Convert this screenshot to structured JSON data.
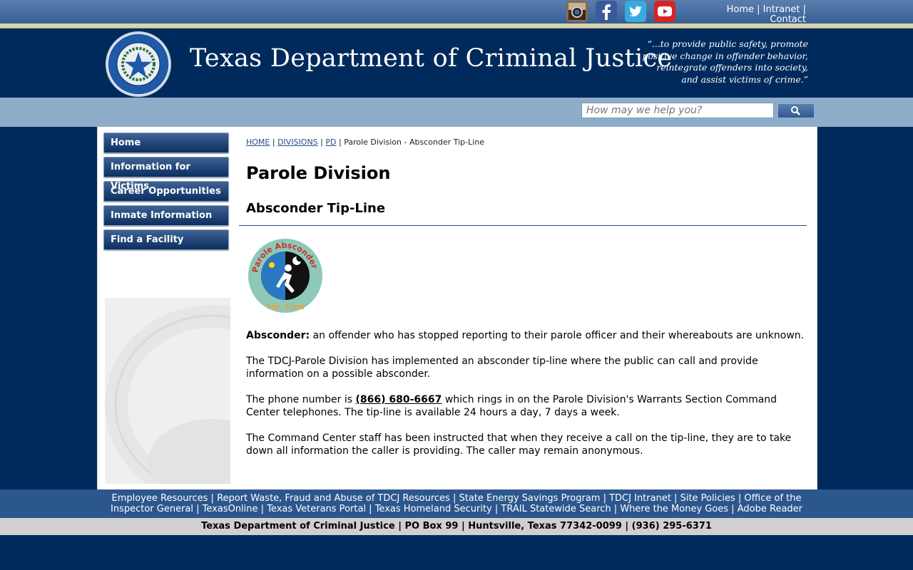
{
  "top_links": {
    "home": "Home",
    "intranet": "Intranet",
    "contact": "Contact",
    "sep": "|"
  },
  "social": [
    "instagram-icon",
    "facebook-icon",
    "twitter-icon",
    "youtube-icon"
  ],
  "header": {
    "agency_name": "Texas Department of Criminal Justice",
    "mission": "“...to provide public safety, promote positive change in offender behavior, reintegrate offenders into society, and assist victims of crime.”"
  },
  "search": {
    "placeholder": "How may we help you?"
  },
  "sidebar": {
    "items": [
      {
        "label": "Home"
      },
      {
        "label": "Information for Victims"
      },
      {
        "label": "Career Opportunities"
      },
      {
        "label": "Inmate Information"
      },
      {
        "label": "Find a Facility"
      }
    ]
  },
  "breadcrumb": {
    "home": "HOME",
    "divisions": "DIVISIONS",
    "pd": "PD",
    "current": "Parole Division - Absconder Tip-Line"
  },
  "main": {
    "page_title": "Parole Division",
    "section_title": "Absconder Tip-Line",
    "definition_term": "Absconder:",
    "definition_text": " an offender who has stopped reporting to their parole officer and their whereabouts are unknown.",
    "para2": "The TDCJ-Parole Division has implemented an absconder tip-line where the public can call and provide information on a possible absconder.",
    "para3_before": "The phone number is ",
    "phone": "(866) 680-6667",
    "para3_after": " which rings in on the Parole Division's Warrants Section Command Center telephones. The tip-line is available 24 hours a day, 7 days a week.",
    "para4": "The Command Center staff has been instructed that when they receive a call on the tip-line, they are to take down all information the caller is providing. The caller may remain anonymous."
  },
  "footer": {
    "links": [
      "Employee Resources",
      "Report Waste, Fraud and Abuse of TDCJ Resources",
      "State Energy Savings Program",
      "TDCJ Intranet",
      "Site Policies",
      "Office of the Inspector General",
      "TexasOnline",
      "Texas Veterans Portal",
      "Texas Homeland Security",
      "TRAIL Statewide Search",
      "Where the Money Goes",
      "Adobe Reader"
    ],
    "address": "Texas Department of Criminal Justice | PO Box 99 | Huntsville, Texas 77342-0099 | (936) 295-6371"
  },
  "colors": {
    "navy": "#002a5c",
    "search_band": "#8eadcb",
    "footer": "#2c578d"
  }
}
